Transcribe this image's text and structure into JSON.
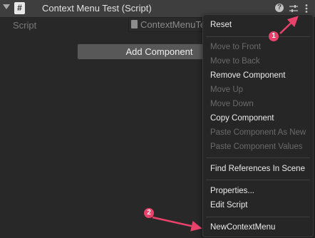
{
  "header": {
    "title": "Context Menu Test (Script)",
    "script_glyph": "#",
    "help_glyph": "?"
  },
  "script_row": {
    "label": "Script",
    "value": "ContextMenuTest"
  },
  "add_component_label": "Add Component",
  "context_menu": {
    "items": [
      {
        "label": "Reset",
        "enabled": true
      },
      {
        "label": "Move to Front",
        "enabled": false
      },
      {
        "label": "Move to Back",
        "enabled": false
      },
      {
        "label": "Remove Component",
        "enabled": true
      },
      {
        "label": "Move Up",
        "enabled": false
      },
      {
        "label": "Move Down",
        "enabled": false
      },
      {
        "label": "Copy Component",
        "enabled": true
      },
      {
        "label": "Paste Component As New",
        "enabled": false
      },
      {
        "label": "Paste Component Values",
        "enabled": false
      },
      {
        "label": "Find References In Scene",
        "enabled": true
      },
      {
        "label": "Properties...",
        "enabled": true
      },
      {
        "label": "Edit Script",
        "enabled": true
      },
      {
        "label": "NewContextMenu",
        "enabled": true
      }
    ]
  },
  "annotations": {
    "badge_1": "1",
    "badge_2": "2",
    "color": "#e8426a"
  },
  "icons": [
    "foldout-arrow-icon",
    "script-icon",
    "help-icon",
    "presets-icon",
    "more-options-icon",
    "file-icon"
  ]
}
